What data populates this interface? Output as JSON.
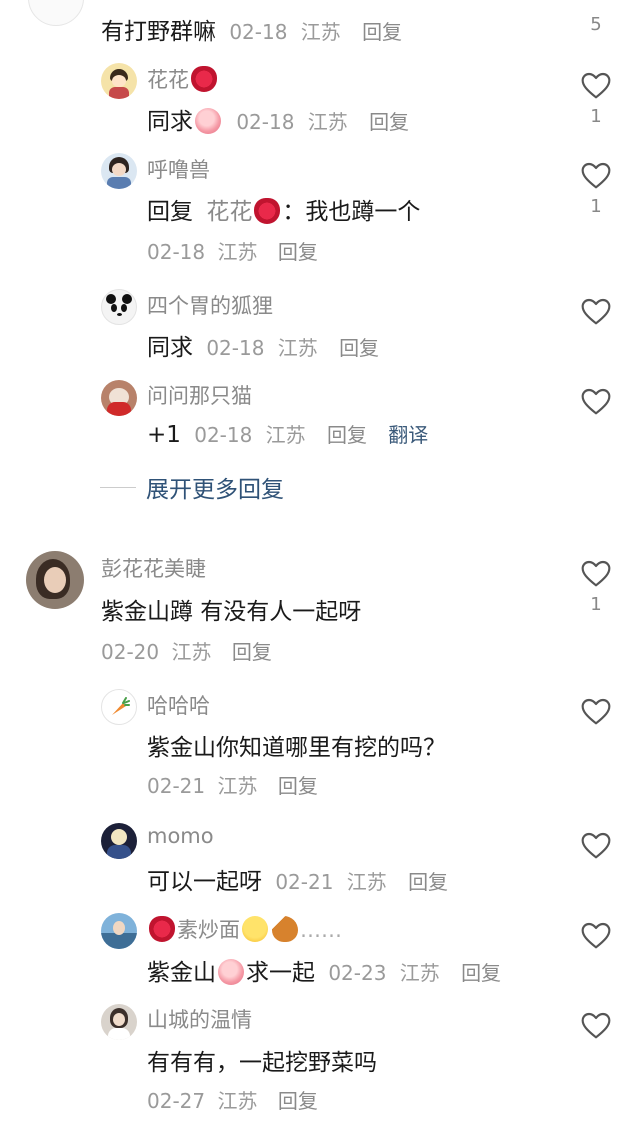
{
  "colors": {
    "link": "#2f5277",
    "meta": "#9a9a9a",
    "name": "#8a8a8a"
  },
  "top": {
    "text": "有打野群嘛",
    "date": "02-18",
    "location": "江苏",
    "reply": "回复",
    "likes": "5"
  },
  "replies1": [
    {
      "name": "花花",
      "name_emoji": "kiss-emoji",
      "text": "同求",
      "text_emoji": "peach-emoji",
      "date": "02-18",
      "location": "江苏",
      "reply": "回复",
      "likes": "1"
    },
    {
      "name": "呼噜兽",
      "prefix": "回复",
      "mention": "花花",
      "mention_emoji": "kiss-emoji",
      "colon": "：",
      "text": "我也蹲一个",
      "date": "02-18",
      "location": "江苏",
      "reply": "回复",
      "likes": "1"
    },
    {
      "name": "四个胃的狐狸",
      "text": "同求",
      "date": "02-18",
      "location": "江苏",
      "reply": "回复"
    },
    {
      "name": "问问那只猫",
      "text": "+1",
      "date": "02-18",
      "location": "江苏",
      "reply": "回复",
      "translate": "翻译"
    }
  ],
  "expand": {
    "label": "展开更多回复"
  },
  "comment2": {
    "name": "彭花花美睫",
    "text": "紫金山蹲 有没有人一起呀",
    "date": "02-20",
    "location": "江苏",
    "reply": "回复",
    "likes": "1"
  },
  "replies2": [
    {
      "name": "哈哈哈",
      "text": "紫金山你知道哪里有挖的吗？",
      "date": "02-21",
      "location": "江苏",
      "reply": "回复"
    },
    {
      "name": "momo",
      "text": "可以一起呀",
      "date": "02-21",
      "location": "江苏",
      "reply": "回复"
    },
    {
      "name": "素炒面",
      "name_suffix": "……",
      "text_a": "紫金山",
      "text_b": "求一起",
      "date": "02-23",
      "location": "江苏",
      "reply": "回复"
    },
    {
      "name": "山城的温情",
      "text": "有有有，一起挖野菜吗",
      "date": "02-27",
      "location": "江苏",
      "reply": "回复"
    }
  ]
}
